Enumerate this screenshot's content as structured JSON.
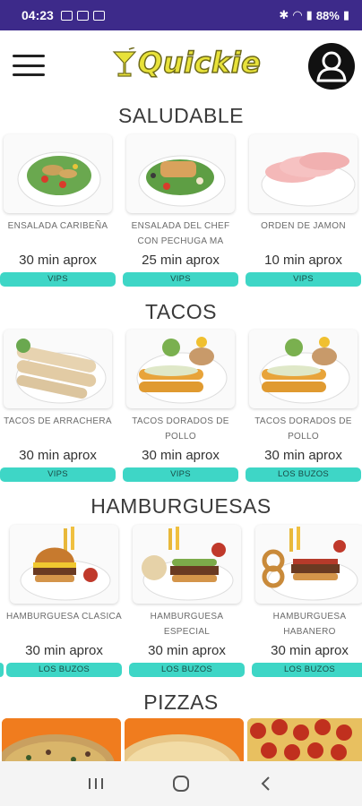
{
  "status_bar": {
    "time": "04:23",
    "battery": "88%"
  },
  "header": {
    "app_name": "Quickie"
  },
  "colors": {
    "status_bar": "#3d2a8a",
    "tag": "#3ed6c6",
    "logo": "#e8e23a"
  },
  "sections": [
    {
      "title": "SALUDABLE",
      "items": [
        {
          "name": "ENSALADA CARIBEÑA",
          "time": "30 min aprox",
          "restaurant": "VIPS",
          "image": "salad"
        },
        {
          "name": "ENSALADA DEL CHEF CON PECHUGA MA",
          "time": "25 min aprox",
          "restaurant": "VIPS",
          "image": "chicken-salad"
        },
        {
          "name": "ORDEN DE JAMON",
          "time": "10 min aprox",
          "restaurant": "VIPS",
          "image": "ham"
        }
      ]
    },
    {
      "title": "TACOS",
      "items": [
        {
          "name": "TACOS DE ARRACHERA",
          "time": "30 min aprox",
          "restaurant": "VIPS",
          "image": "tacos"
        },
        {
          "name": "TACOS DORADOS DE POLLO",
          "time": "30 min aprox",
          "restaurant": "VIPS",
          "image": "flautas"
        },
        {
          "name": "TACOS DORADOS DE POLLO",
          "time": "30 min aprox",
          "restaurant": "LOS BUZOS",
          "image": "flautas"
        }
      ]
    },
    {
      "title": "HAMBURGUESAS",
      "items": [
        {
          "name": "HAMBURGUESA CLASICA",
          "time": "30 min aprox",
          "restaurant": "LOS BUZOS",
          "image": "burger"
        },
        {
          "name": "HAMBURGUESA ESPECIAL",
          "time": "30 min aprox",
          "restaurant": "LOS BUZOS",
          "image": "burger-avocado"
        },
        {
          "name": "HAMBURGUESA HABANERO",
          "time": "30 min aprox",
          "restaurant": "LOS BUZOS",
          "image": "burger-onion"
        }
      ]
    },
    {
      "title": "PIZZAS"
    }
  ]
}
